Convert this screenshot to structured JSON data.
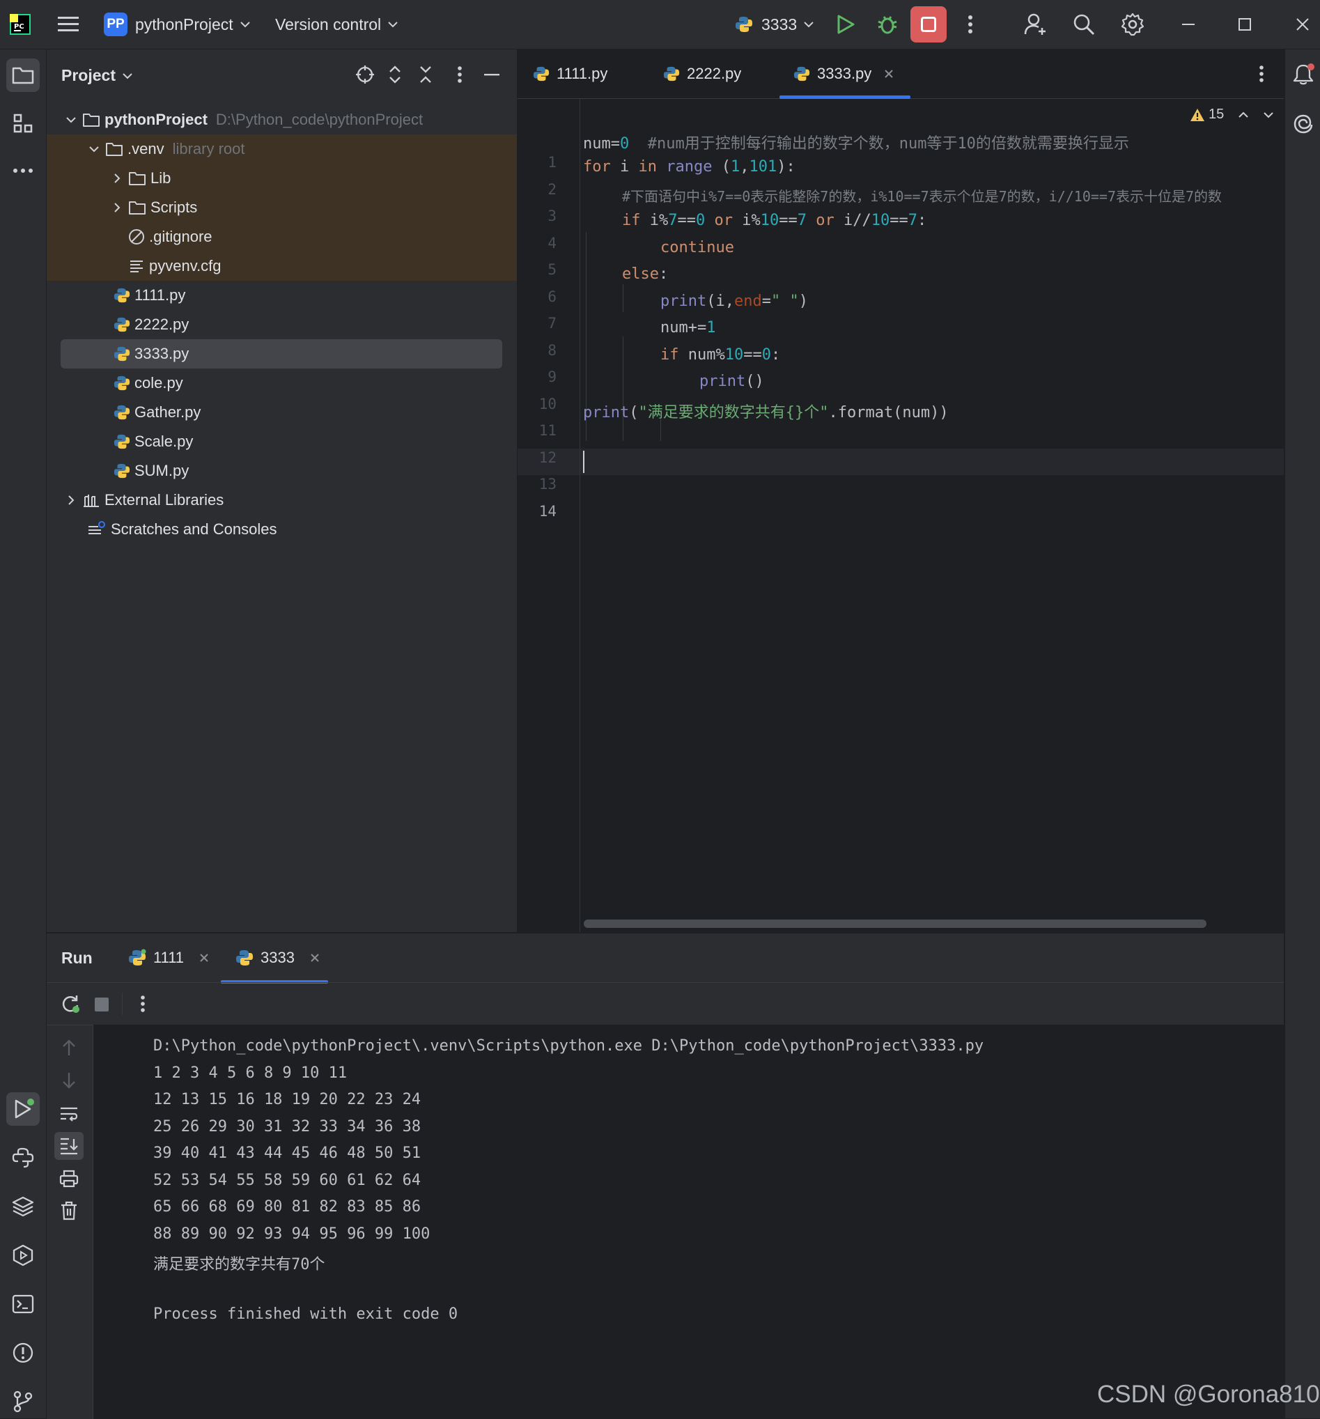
{
  "titlebar": {
    "project_badge": "PP",
    "project_name": "pythonProject",
    "vcs": "Version control",
    "run_config": "3333"
  },
  "project_panel": {
    "title": "Project",
    "tree": [
      {
        "label": "pythonProject",
        "hint": "D:\\Python_code\\pythonProject"
      },
      {
        "label": ".venv",
        "hint": "library root"
      },
      {
        "label": "Lib"
      },
      {
        "label": "Scripts"
      },
      {
        "label": ".gitignore"
      },
      {
        "label": "pyvenv.cfg"
      },
      {
        "label": "1111.py"
      },
      {
        "label": "2222.py"
      },
      {
        "label": "3333.py"
      },
      {
        "label": "cole.py"
      },
      {
        "label": "Gather.py"
      },
      {
        "label": "Scale.py"
      },
      {
        "label": "SUM.py"
      },
      {
        "label": "External Libraries"
      },
      {
        "label": "Scratches and Consoles"
      }
    ]
  },
  "editor": {
    "tabs": [
      "1111.py",
      "2222.py",
      "3333.py"
    ],
    "active_tab": "3333.py",
    "warning_count": "15",
    "line_numbers": [
      "1",
      "2",
      "3",
      "4",
      "5",
      "6",
      "7",
      "8",
      "9",
      "10",
      "11",
      "12",
      "13",
      "14"
    ],
    "code": {
      "l2_a": "num=",
      "l2_b": "0",
      "l2_c": "  #num用于控制每行输出的数字个数，num等于10的倍数就需要换行显示",
      "l3_a": "for",
      "l3_b": " i ",
      "l3_c": "in",
      "l3_d": " ",
      "l3_e": "range",
      "l3_f": " (",
      "l3_g": "1",
      "l3_h": ",",
      "l3_i": "101",
      "l3_j": "):",
      "l4": "#下面语句中i%7==0表示能整除7的数，i%10==7表示个位是7的数，i//10==7表示十位是7的数",
      "l5_a": "if",
      "l5_b": " i%",
      "l5_c": "7",
      "l5_d": "==",
      "l5_e": "0",
      "l5_f": " ",
      "l5_g": "or",
      "l5_h": " i%",
      "l5_i": "10",
      "l5_j": "==",
      "l5_k": "7",
      "l5_l": " ",
      "l5_m": "or",
      "l5_n": " i//",
      "l5_o": "10",
      "l5_p": "==",
      "l5_q": "7",
      "l5_r": ":",
      "l6": "continue",
      "l7_a": "else",
      "l7_b": ":",
      "l8_a": "print",
      "l8_b": "(i,",
      "l8_c": "end",
      "l8_d": "=",
      "l8_e": "\" \"",
      "l8_f": ")",
      "l9_a": "num+=",
      "l9_b": "1",
      "l10_a": "if",
      "l10_b": " num%",
      "l10_c": "10",
      "l10_d": "==",
      "l10_e": "0",
      "l10_f": ":",
      "l11_a": "print",
      "l11_b": "()",
      "l12_a": "print",
      "l12_b": "(",
      "l12_c": "\"满足要求的数字共有{}个\"",
      "l12_d": ".format(num))"
    }
  },
  "run_panel": {
    "title": "Run",
    "tabs": [
      "1111",
      "3333"
    ],
    "active_tab": "3333",
    "output": [
      "D:\\Python_code\\pythonProject\\.venv\\Scripts\\python.exe D:\\Python_code\\pythonProject\\3333.py",
      "1 2 3 4 5 6 8 9 10 11",
      "12 13 15 16 18 19 20 22 23 24",
      "25 26 29 30 31 32 33 34 36 38",
      "39 40 41 43 44 45 46 48 50 51",
      "52 53 54 55 58 59 60 61 62 64",
      "65 66 68 69 80 81 82 83 85 86",
      "88 89 90 92 93 94 95 96 99 100",
      "满足要求的数字共有70个",
      "",
      "Process finished with exit code 0"
    ]
  },
  "watermark": "CSDN @Gorona810",
  "colors": {
    "accent": "#3574f0",
    "stop": "#db5c5c",
    "run_green": "#5fb865",
    "keyword": "#cf8e6d",
    "number": "#2aacb8",
    "builtin": "#8888c6",
    "string": "#6aab73",
    "comment": "#7a7e85"
  }
}
